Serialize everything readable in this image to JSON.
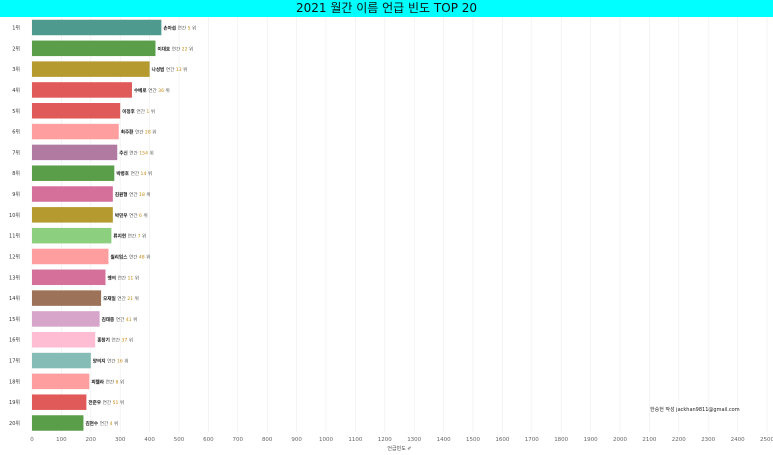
{
  "title": "2021 월간 이름 언급 빈도 TOP 20",
  "credit": "한승헌 작성 jackhan9811@gmail.com",
  "chart_data": {
    "type": "bar",
    "orientation": "horizontal",
    "title": "2021 월간 이름 언급 빈도 TOP 20",
    "xlabel": "언급빈도 ✐",
    "ylabel": "",
    "xlim": [
      0,
      2500
    ],
    "xticks": [
      0,
      100,
      200,
      300,
      400,
      500,
      600,
      700,
      800,
      900,
      1000,
      1100,
      1200,
      1300,
      1400,
      1500,
      1600,
      1700,
      1800,
      1900,
      2000,
      2100,
      2200,
      2300,
      2400,
      2500
    ],
    "grid": true,
    "rank_suffix": "위",
    "bars": [
      {
        "rank": "1위",
        "name": "손아섭",
        "mid": "연간",
        "num": "5",
        "suffix": "위",
        "value": 440,
        "color": "#4e9a8e"
      },
      {
        "rank": "2위",
        "name": "이대호",
        "mid": "연간",
        "num": "22",
        "suffix": "위",
        "value": 420,
        "color": "#5a9e4a"
      },
      {
        "rank": "3위",
        "name": "나성범",
        "mid": "연간",
        "num": "13",
        "suffix": "위",
        "value": 400,
        "color": "#b59a30"
      },
      {
        "rank": "4위",
        "name": "수베로",
        "mid": "연간",
        "num": "36",
        "suffix": "위",
        "value": 340,
        "color": "#e05a5a"
      },
      {
        "rank": "5위",
        "name": "이정후",
        "mid": "연간",
        "num": "1",
        "suffix": "위",
        "value": 300,
        "color": "#e05a5a"
      },
      {
        "rank": "6위",
        "name": "최주환",
        "mid": "연간",
        "num": "28",
        "suffix": "위",
        "value": 295,
        "color": "#ff9e9e"
      },
      {
        "rank": "7위",
        "name": "추신",
        "mid": "연간",
        "num": "154",
        "suffix": "위",
        "value": 290,
        "color": "#b07aa1"
      },
      {
        "rank": "8위",
        "name": "박병호",
        "mid": "연간",
        "num": "14",
        "suffix": "위",
        "value": 280,
        "color": "#5a9e4a"
      },
      {
        "rank": "9위",
        "name": "김원형",
        "mid": "연간",
        "num": "18",
        "suffix": "위",
        "value": 275,
        "color": "#d4709a"
      },
      {
        "rank": "10위",
        "name": "박민우",
        "mid": "연간",
        "num": "6",
        "suffix": "위",
        "value": 275,
        "color": "#b59a30"
      },
      {
        "rank": "11위",
        "name": "류지현",
        "mid": "연간",
        "num": "7",
        "suffix": "위",
        "value": 270,
        "color": "#8ccf7e"
      },
      {
        "rank": "12위",
        "name": "윌리엄스",
        "mid": "연간",
        "num": "48",
        "suffix": "위",
        "value": 260,
        "color": "#ff9e9e"
      },
      {
        "rank": "13위",
        "name": "멩의",
        "mid": "연간",
        "num": "11",
        "suffix": "위",
        "value": 250,
        "color": "#d4709a"
      },
      {
        "rank": "14위",
        "name": "오재일",
        "mid": "연간",
        "num": "21",
        "suffix": "위",
        "value": 235,
        "color": "#9c7358"
      },
      {
        "rank": "15위",
        "name": "김태종",
        "mid": "연간",
        "num": "41",
        "suffix": "위",
        "value": 230,
        "color": "#d6a5c9"
      },
      {
        "rank": "16위",
        "name": "홍창기",
        "mid": "연간",
        "num": "37",
        "suffix": "위",
        "value": 215,
        "color": "#ffbdd4"
      },
      {
        "rank": "17위",
        "name": "양의지",
        "mid": "연간",
        "num": "16",
        "suffix": "위",
        "value": 200,
        "color": "#86bcb6"
      },
      {
        "rank": "18위",
        "name": "피렐라",
        "mid": "연간",
        "num": "8",
        "suffix": "위",
        "value": 195,
        "color": "#ff9e9e"
      },
      {
        "rank": "19위",
        "name": "전준우",
        "mid": "연간",
        "num": "51",
        "suffix": "위",
        "value": 185,
        "color": "#e05a5a"
      },
      {
        "rank": "20위",
        "name": "김현수",
        "mid": "연간",
        "num": "4",
        "suffix": "위",
        "value": 175,
        "color": "#5a9e4a"
      }
    ]
  }
}
